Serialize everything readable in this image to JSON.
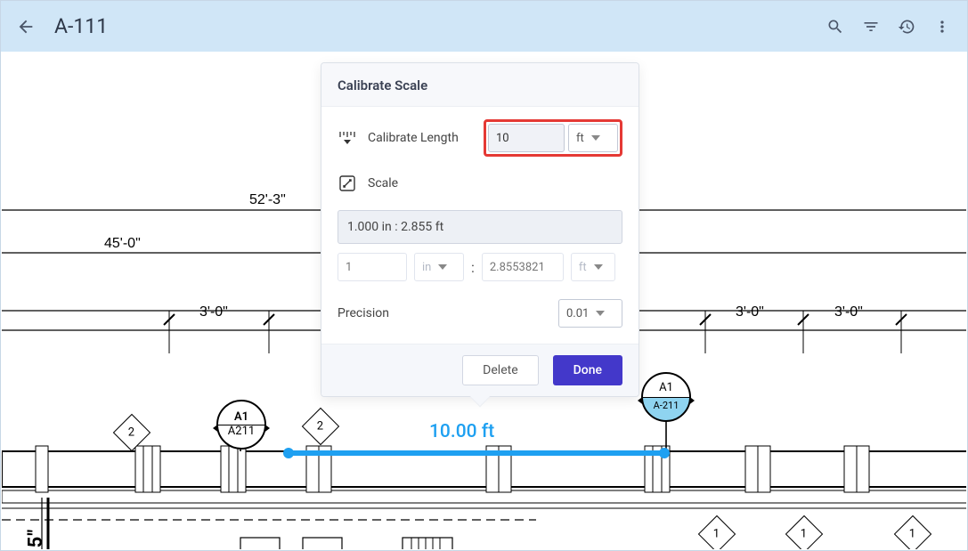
{
  "header": {
    "title": "A-111"
  },
  "modal": {
    "title": "Calibrate Scale",
    "calibrate_label": "Calibrate Length",
    "calibrate_value": "10",
    "calibrate_unit": "ft",
    "scale_label": "Scale",
    "scale_readout": "1.000 in : 2.855 ft",
    "scale_left_value": "1",
    "scale_left_unit": "in",
    "scale_right_value": "2.8553821",
    "scale_right_unit": "ft",
    "precision_label": "Precision",
    "precision_value": "0.01",
    "delete_label": "Delete",
    "done_label": "Done"
  },
  "ruler_label": "10.00 ft",
  "dims": {
    "d1": "52'-3\"",
    "d2": "45'-0\"",
    "d3a": "3'-0\"",
    "d3b": "3'-0\"",
    "d3c": "3'-0\""
  },
  "callouts": {
    "left_top": "A1",
    "left_bot": "A211",
    "right_top": "A1",
    "right_bot": "A-211"
  },
  "diamonds": {
    "a": "2",
    "b": "2",
    "c": "1",
    "d": "1",
    "e": "1"
  },
  "side_label": "-5\""
}
